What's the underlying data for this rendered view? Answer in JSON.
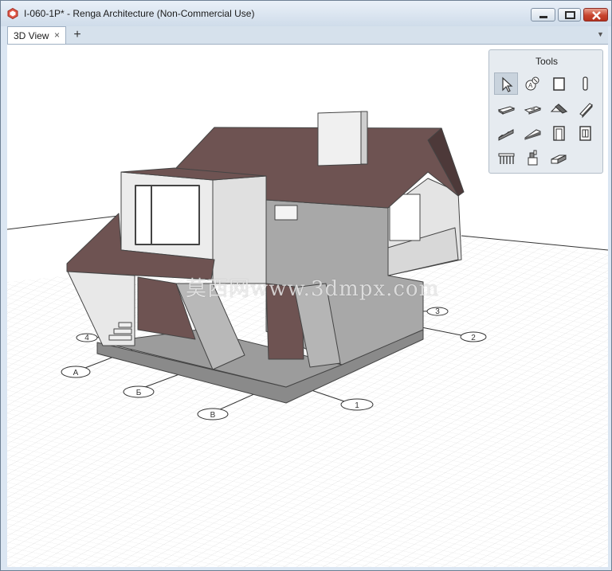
{
  "window": {
    "title": "I-060-1P* - Renga Architecture (Non-Commercial Use)"
  },
  "tabs": [
    {
      "label": "3D View",
      "active": true,
      "close_glyph": "×"
    }
  ],
  "tab_add_glyph": "+",
  "tab_menu_glyph": "▼",
  "tools_panel": {
    "title": "Tools",
    "tools": [
      {
        "icon": "select-arrow-icon",
        "selected": true
      },
      {
        "icon": "axis-label-icon",
        "selected": false
      },
      {
        "icon": "wall-icon",
        "selected": false
      },
      {
        "icon": "column-icon",
        "selected": false
      },
      {
        "icon": "floor-slab-icon",
        "selected": false
      },
      {
        "icon": "opening-slab-icon",
        "selected": false
      },
      {
        "icon": "roof-icon",
        "selected": false
      },
      {
        "icon": "beam-icon",
        "selected": false
      },
      {
        "icon": "stair-icon",
        "selected": false
      },
      {
        "icon": "ramp-icon",
        "selected": false
      },
      {
        "icon": "door-icon",
        "selected": false
      },
      {
        "icon": "window-icon",
        "selected": false
      },
      {
        "icon": "railing-icon",
        "selected": false
      },
      {
        "icon": "element-icon",
        "selected": false
      },
      {
        "icon": "line-element-icon",
        "selected": false
      }
    ]
  },
  "grid_axes": [
    "A",
    "Б",
    "В",
    "1",
    "2",
    "3",
    "4"
  ],
  "watermark": "莫西网www.3dmpx.com",
  "colors": {
    "roof": "#6e5352",
    "wall_light": "#e9e9e9",
    "wall_grey": "#a8a8a8",
    "base": "#8a8a8a",
    "accent_close": "#c8452f"
  }
}
